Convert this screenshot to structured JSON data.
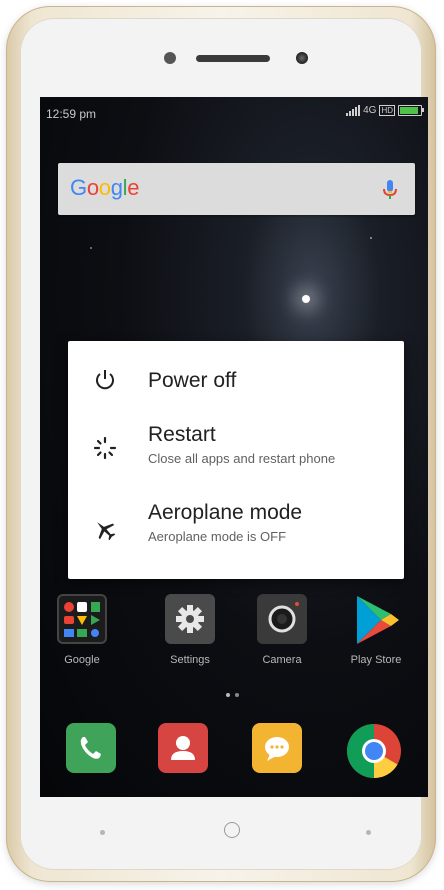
{
  "status_bar": {
    "time": "12:59 pm",
    "network": "4G",
    "hd_badge": "HD",
    "icons": [
      "signal-icon",
      "network-4g-icon",
      "battery-icon"
    ]
  },
  "search_bar": {
    "logo_text": "Google",
    "logo_colors": [
      "#4285F4",
      "#EA4335",
      "#FBBC05",
      "#4285F4",
      "#34A853",
      "#EA4335"
    ],
    "icon": "mic-icon"
  },
  "power_menu": {
    "options": [
      {
        "title": "Power off",
        "subtitle": "",
        "icon": "power-icon"
      },
      {
        "title": "Restart",
        "subtitle": "Close all apps and restart phone",
        "icon": "restart-icon"
      },
      {
        "title": "Aeroplane mode",
        "subtitle": "Aeroplane mode is OFF",
        "icon": "airplane-icon"
      }
    ]
  },
  "home_apps": [
    {
      "label": "Google",
      "icon": "google-folder-icon"
    },
    {
      "label": "Settings",
      "icon": "gear-icon"
    },
    {
      "label": "Camera",
      "icon": "camera-icon"
    },
    {
      "label": "Play Store",
      "icon": "play-store-icon"
    }
  ],
  "dock": [
    {
      "icon": "phone-icon",
      "color": "#3fa35a"
    },
    {
      "icon": "contacts-icon",
      "color": "#d64541"
    },
    {
      "icon": "messages-icon",
      "color": "#f2b431"
    },
    {
      "icon": "chrome-icon",
      "color": "#4285F4"
    }
  ],
  "colors": {
    "dialog_bg": "#ffffff",
    "phone_body": "#f3f3f3",
    "battery_fill": "#4fc349"
  }
}
